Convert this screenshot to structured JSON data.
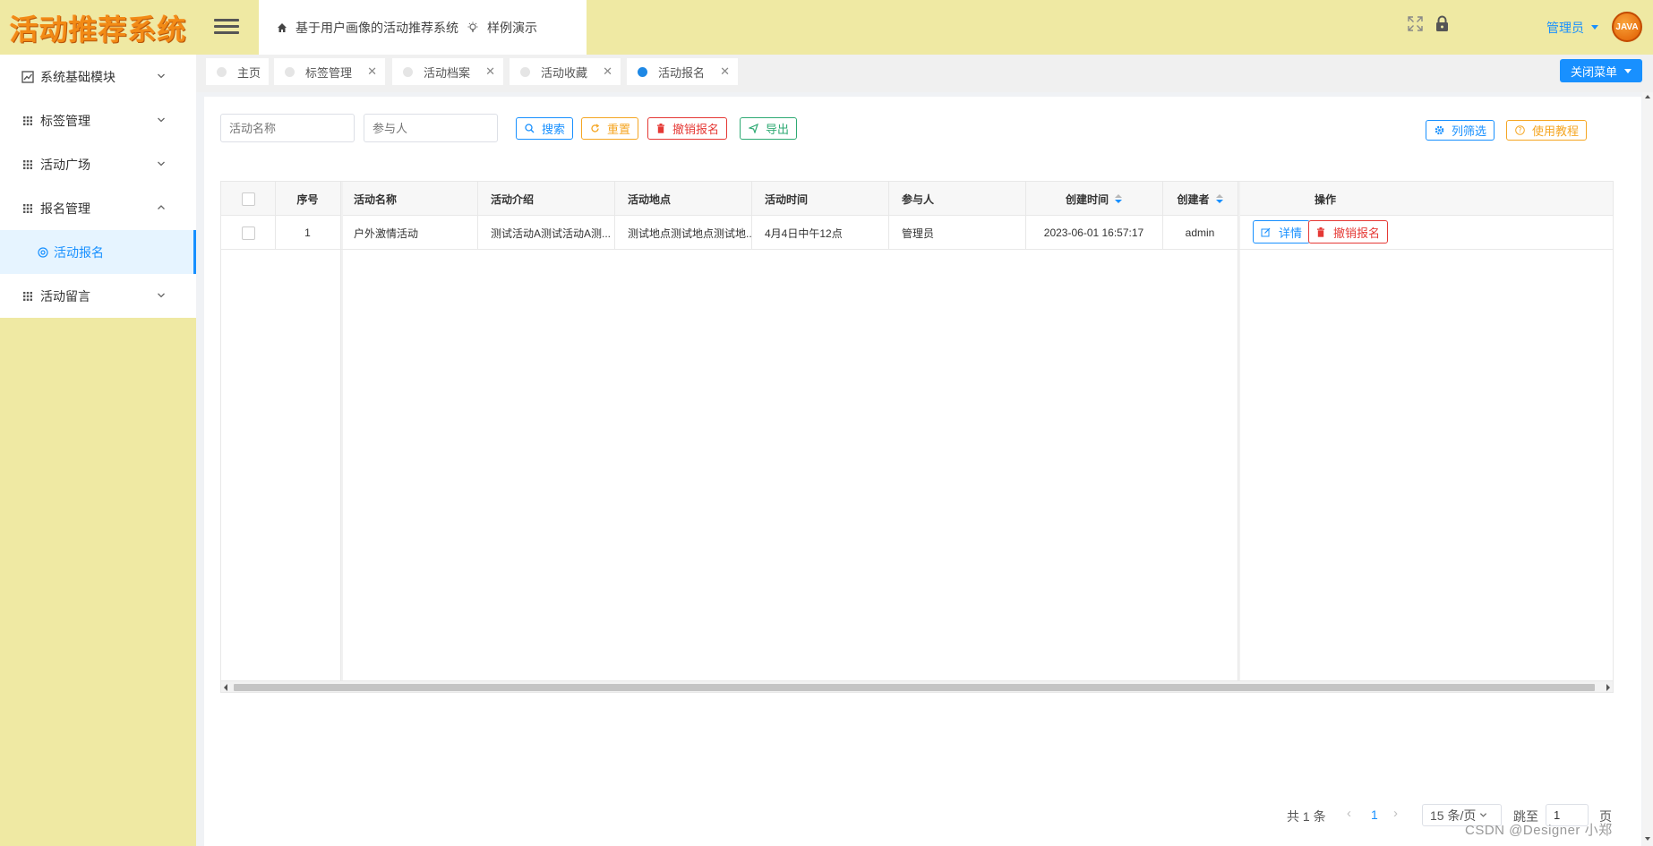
{
  "app": {
    "logo_text": "活动推荐系统"
  },
  "header": {
    "nav": [
      {
        "label": "基于用户画像的活动推荐系统",
        "icon": "home-icon"
      },
      {
        "label": "样例演示",
        "icon": "bulb-icon"
      }
    ],
    "user": {
      "name": "管理员",
      "avatar_text": "JAVA"
    }
  },
  "sidebar": {
    "items": [
      {
        "label": "系统基础模块",
        "icon": "chart-icon",
        "expanded": false
      },
      {
        "label": "标签管理",
        "icon": "grid-icon",
        "expanded": false
      },
      {
        "label": "活动广场",
        "icon": "grid-icon",
        "expanded": false
      },
      {
        "label": "报名管理",
        "icon": "grid-icon",
        "expanded": true
      },
      {
        "label": "活动留言",
        "icon": "grid-icon",
        "expanded": false
      }
    ],
    "sub_item": {
      "label": "活动报名",
      "icon": "circle-gear-icon"
    }
  },
  "tabs": [
    {
      "label": "主页",
      "closable": false
    },
    {
      "label": "标签管理",
      "closable": true
    },
    {
      "label": "活动档案",
      "closable": true
    },
    {
      "label": "活动收藏",
      "closable": true
    },
    {
      "label": "活动报名",
      "closable": true,
      "active": true
    }
  ],
  "close_menu_label": "关闭菜单",
  "search": {
    "activity_name_placeholder": "活动名称",
    "participant_placeholder": "参与人",
    "search_label": "搜索",
    "reset_label": "重置",
    "cancel_signup_label": "撤销报名",
    "export_label": "导出",
    "column_filter_label": "列筛选",
    "tutorial_label": "使用教程"
  },
  "table": {
    "columns": [
      "序号",
      "活动名称",
      "活动介绍",
      "活动地点",
      "活动时间",
      "参与人",
      "创建时间",
      "创建者",
      "操作"
    ],
    "rows": [
      {
        "index": "1",
        "name": "户外激情活动",
        "intro": "测试活动A测试活动A测...",
        "location": "测试地点测试地点测试地...",
        "time": "4月4日中午12点",
        "participant": "管理员",
        "created_at": "2023-06-01 16:57:17",
        "creator": "admin"
      }
    ],
    "row_actions": {
      "detail_label": "详情",
      "cancel_label": "撤销报名"
    }
  },
  "pagination": {
    "total_text": "共 1 条",
    "current_page": "1",
    "page_size": "15 条/页",
    "jump_label": "跳至",
    "jump_value": "1",
    "page_suffix": "页"
  },
  "watermark": "CSDN @Designer 小郑",
  "colors": {
    "accent": "#1890ff",
    "header_bg": "#efe9a3",
    "logo": "#f28a15",
    "danger": "#e53935",
    "warning": "#f5a623",
    "success": "#2eaa73"
  }
}
